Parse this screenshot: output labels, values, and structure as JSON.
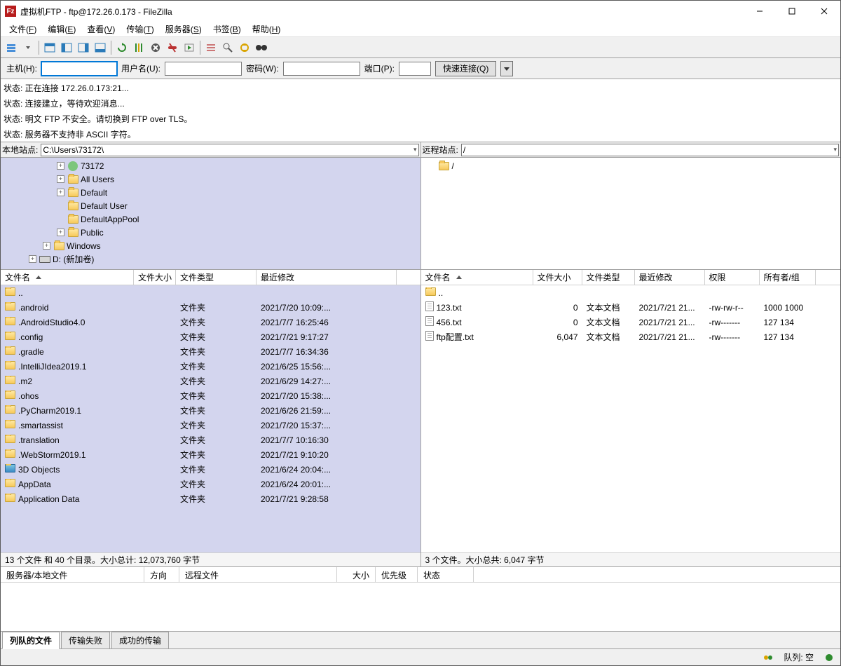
{
  "title": "虚拟机FTP - ftp@172.26.0.173 - FileZilla",
  "menu": [
    "文件(F)",
    "编辑(E)",
    "查看(V)",
    "传输(T)",
    "服务器(S)",
    "书签(B)",
    "帮助(H)"
  ],
  "qc": {
    "host_l": "主机(H):",
    "user_l": "用户名(U):",
    "pass_l": "密码(W):",
    "port_l": "端口(P):",
    "btn": "快速连接(Q)",
    "host": "",
    "user": "",
    "pass": "",
    "port": ""
  },
  "log": [
    {
      "l": "状态:",
      "m": "正在连接 172.26.0.173:21..."
    },
    {
      "l": "状态:",
      "m": "连接建立，等待欢迎消息..."
    },
    {
      "l": "状态:",
      "m": "明文 FTP 不安全。请切换到 FTP over TLS。"
    },
    {
      "l": "状态:",
      "m": "服务器不支持非 ASCII 字符。"
    }
  ],
  "local": {
    "label": "本地站点:",
    "path": "C:\\Users\\73172\\",
    "tree": [
      {
        "ind": 80,
        "exp": "+",
        "icon": "user",
        "t": "73172"
      },
      {
        "ind": 80,
        "exp": "+",
        "icon": "folder",
        "t": "All Users"
      },
      {
        "ind": 80,
        "exp": "+",
        "icon": "folder",
        "t": "Default"
      },
      {
        "ind": 80,
        "exp": "",
        "icon": "folder",
        "t": "Default User"
      },
      {
        "ind": 80,
        "exp": "",
        "icon": "folder",
        "t": "DefaultAppPool"
      },
      {
        "ind": 80,
        "exp": "+",
        "icon": "folder",
        "t": "Public"
      },
      {
        "ind": 60,
        "exp": "+",
        "icon": "folder",
        "t": "Windows"
      },
      {
        "ind": 40,
        "exp": "+",
        "icon": "drive",
        "t": "D: (新加卷)"
      }
    ],
    "cols": [
      "文件名",
      "文件大小",
      "文件类型",
      "最近修改"
    ],
    "rows": [
      {
        "n": "..",
        "s": "",
        "t": "",
        "m": "",
        "i": "folder"
      },
      {
        "n": ".android",
        "s": "",
        "t": "文件夹",
        "m": "2021/7/20 10:09:...",
        "i": "folder"
      },
      {
        "n": ".AndroidStudio4.0",
        "s": "",
        "t": "文件夹",
        "m": "2021/7/7 16:25:46",
        "i": "folder"
      },
      {
        "n": ".config",
        "s": "",
        "t": "文件夹",
        "m": "2021/7/21 9:17:27",
        "i": "folder"
      },
      {
        "n": ".gradle",
        "s": "",
        "t": "文件夹",
        "m": "2021/7/7 16:34:36",
        "i": "folder"
      },
      {
        "n": ".IntelliJIdea2019.1",
        "s": "",
        "t": "文件夹",
        "m": "2021/6/25 15:56:...",
        "i": "folder"
      },
      {
        "n": ".m2",
        "s": "",
        "t": "文件夹",
        "m": "2021/6/29 14:27:...",
        "i": "folder"
      },
      {
        "n": ".ohos",
        "s": "",
        "t": "文件夹",
        "m": "2021/7/20 15:38:...",
        "i": "folder"
      },
      {
        "n": ".PyCharm2019.1",
        "s": "",
        "t": "文件夹",
        "m": "2021/6/26 21:59:...",
        "i": "folder"
      },
      {
        "n": ".smartassist",
        "s": "",
        "t": "文件夹",
        "m": "2021/7/20 15:37:...",
        "i": "folder"
      },
      {
        "n": ".translation",
        "s": "",
        "t": "文件夹",
        "m": "2021/7/7 10:16:30",
        "i": "folder"
      },
      {
        "n": ".WebStorm2019.1",
        "s": "",
        "t": "文件夹",
        "m": "2021/7/21 9:10:20",
        "i": "folder"
      },
      {
        "n": "3D Objects",
        "s": "",
        "t": "文件夹",
        "m": "2021/6/24 20:04:...",
        "i": "folder3d"
      },
      {
        "n": "AppData",
        "s": "",
        "t": "文件夹",
        "m": "2021/6/24 20:01:...",
        "i": "folder"
      },
      {
        "n": "Application Data",
        "s": "",
        "t": "文件夹",
        "m": "2021/7/21 9:28:58",
        "i": "folder"
      }
    ],
    "status": "13 个文件 和 40 个目录。大小总计: 12,073,760 字节"
  },
  "remote": {
    "label": "远程站点:",
    "path": "/",
    "tree": [
      {
        "ind": 10,
        "exp": "",
        "icon": "folder",
        "t": "/"
      }
    ],
    "cols": [
      "文件名",
      "文件大小",
      "文件类型",
      "最近修改",
      "权限",
      "所有者/组"
    ],
    "rows": [
      {
        "n": "..",
        "s": "",
        "t": "",
        "m": "",
        "p": "",
        "o": "",
        "i": "folder"
      },
      {
        "n": "123.txt",
        "s": "0",
        "t": "文本文档",
        "m": "2021/7/21 21...",
        "p": "-rw-rw-r--",
        "o": "1000 1000",
        "i": "file"
      },
      {
        "n": "456.txt",
        "s": "0",
        "t": "文本文档",
        "m": "2021/7/21 21...",
        "p": "-rw-------",
        "o": "127 134",
        "i": "file"
      },
      {
        "n": "ftp配置.txt",
        "s": "6,047",
        "t": "文本文档",
        "m": "2021/7/21 21...",
        "p": "-rw-------",
        "o": "127 134",
        "i": "file"
      }
    ],
    "status": "3 个文件。大小总共: 6,047 字节"
  },
  "queue": {
    "cols": [
      "服务器/本地文件",
      "方向",
      "远程文件",
      "大小",
      "优先级",
      "状态"
    ]
  },
  "tabs": [
    "列队的文件",
    "传输失败",
    "成功的传输"
  ],
  "statusbar": {
    "queue": "队列: 空"
  }
}
